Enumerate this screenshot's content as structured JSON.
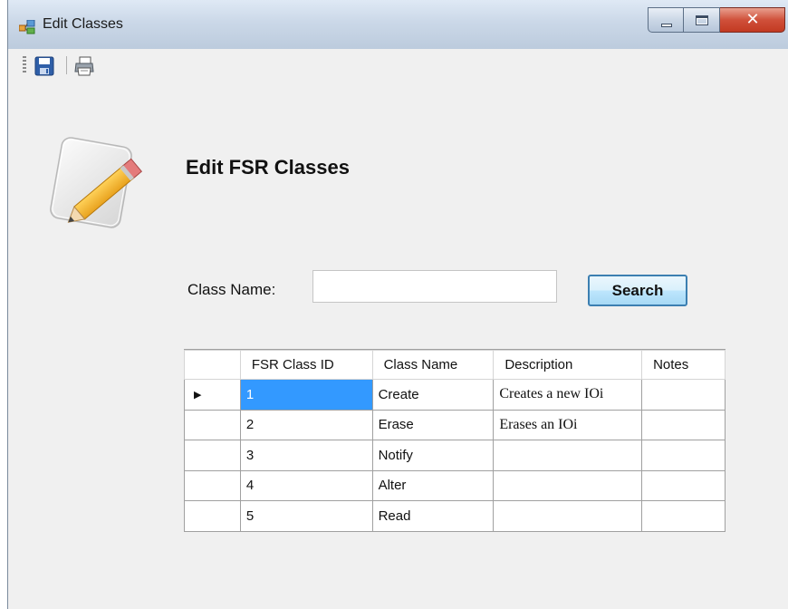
{
  "window": {
    "title": "Edit Classes"
  },
  "toolbar": {
    "save_icon": "save-icon",
    "print_icon": "print-icon"
  },
  "form": {
    "heading": "Edit FSR Classes",
    "class_name_label": "Class Name:",
    "class_name_value": "",
    "search_label": "Search"
  },
  "grid": {
    "columns": [
      "FSR Class ID",
      "Class Name",
      "Description",
      "Notes"
    ],
    "current_row_marker": "▶",
    "rows": [
      {
        "id": "1",
        "name": "Create",
        "description": "Creates a new IOi",
        "notes": ""
      },
      {
        "id": "2",
        "name": "Erase",
        "description": "Erases an IOi",
        "notes": ""
      },
      {
        "id": "3",
        "name": "Notify",
        "description": "",
        "notes": ""
      },
      {
        "id": "4",
        "name": "Alter",
        "description": "",
        "notes": ""
      },
      {
        "id": "5",
        "name": "Read",
        "description": "",
        "notes": ""
      }
    ]
  },
  "colors": {
    "selection": "#3399ff",
    "search_border": "#3c7fb1"
  }
}
